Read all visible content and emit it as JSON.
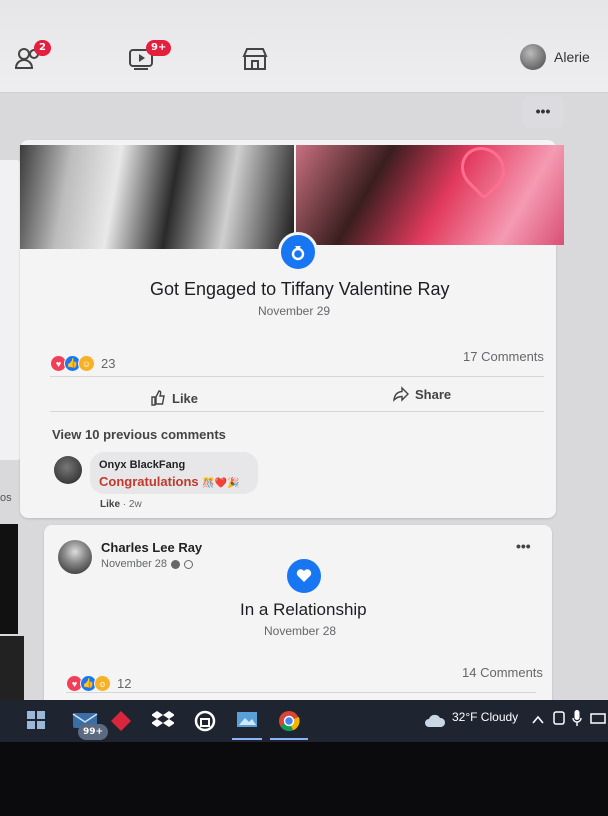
{
  "nav": {
    "friends_badge": "2",
    "watch_badge": "9+",
    "profile_name": "Alerie"
  },
  "post1": {
    "title": "Got Engaged to Tiffany Valentine Ray",
    "date": "November 29",
    "reaction_count": "23",
    "comments": "17 Comments",
    "like_label": "Like",
    "share_label": "Share",
    "view_previous": "View 10 previous comments",
    "comment": {
      "author": "Onyx BlackFang",
      "text": "Congratulations",
      "emojis": "🎊❤️🎉",
      "like_action": "Like",
      "time": "2w"
    }
  },
  "post2": {
    "author": "Charles Lee Ray",
    "date": "November 28",
    "event_title": "In a Relationship",
    "event_date": "November 28",
    "reaction_count": "12",
    "comments": "14 Comments"
  },
  "left": {
    "partial_text": "os"
  },
  "taskbar": {
    "mail_badge": "99+",
    "weather": "32°F  Cloudy"
  },
  "colors": {
    "accent": "#1876f2",
    "love": "#f33e58",
    "comment_text": "#c0392b"
  }
}
